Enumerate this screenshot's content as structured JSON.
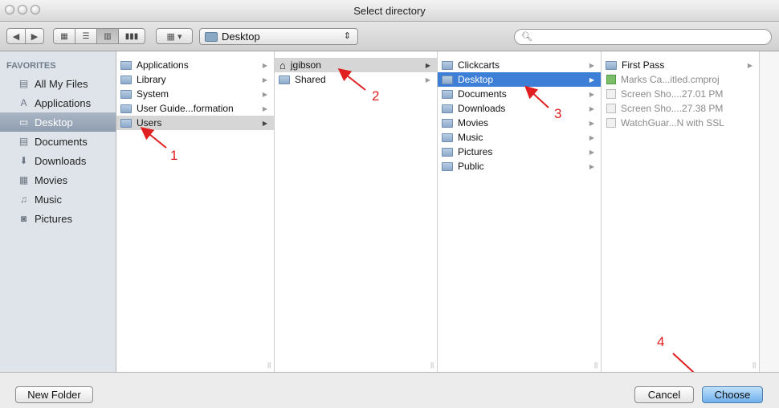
{
  "window": {
    "title": "Select directory"
  },
  "toolbar": {
    "location": "Desktop",
    "search_placeholder": ""
  },
  "sidebar": {
    "section_title": "FAVORITES",
    "items": [
      {
        "label": "All My Files",
        "icon": "all-files-icon"
      },
      {
        "label": "Applications",
        "icon": "applications-icon"
      },
      {
        "label": "Desktop",
        "icon": "desktop-icon",
        "selected": true
      },
      {
        "label": "Documents",
        "icon": "documents-icon"
      },
      {
        "label": "Downloads",
        "icon": "downloads-icon"
      },
      {
        "label": "Movies",
        "icon": "movies-icon"
      },
      {
        "label": "Music",
        "icon": "music-icon"
      },
      {
        "label": "Pictures",
        "icon": "pictures-icon"
      }
    ]
  },
  "columns": {
    "col1": [
      {
        "label": "Applications"
      },
      {
        "label": "Library"
      },
      {
        "label": "System"
      },
      {
        "label": "User Guide...formation"
      },
      {
        "label": "Users",
        "selected": "gray"
      }
    ],
    "col2": [
      {
        "label": "jgibson",
        "selected": "gray"
      },
      {
        "label": "Shared"
      }
    ],
    "col3": [
      {
        "label": "Clickcarts"
      },
      {
        "label": "Desktop",
        "selected": "blue"
      },
      {
        "label": "Documents"
      },
      {
        "label": "Downloads"
      },
      {
        "label": "Movies"
      },
      {
        "label": "Music"
      },
      {
        "label": "Pictures"
      },
      {
        "label": "Public"
      }
    ],
    "col4": [
      {
        "label": "First Pass"
      },
      {
        "label": "Marks Ca...itled.cmproj"
      },
      {
        "label": "Screen Sho....27.01 PM"
      },
      {
        "label": "Screen Sho....27.38 PM"
      },
      {
        "label": "WatchGuar...N with SSL"
      }
    ]
  },
  "annotations": [
    "1",
    "2",
    "3",
    "4"
  ],
  "buttons": {
    "new_folder": "New Folder",
    "cancel": "Cancel",
    "choose": "Choose"
  },
  "colors": {
    "selection_blue": "#3d7fd6",
    "annotation_red": "#e02020"
  }
}
